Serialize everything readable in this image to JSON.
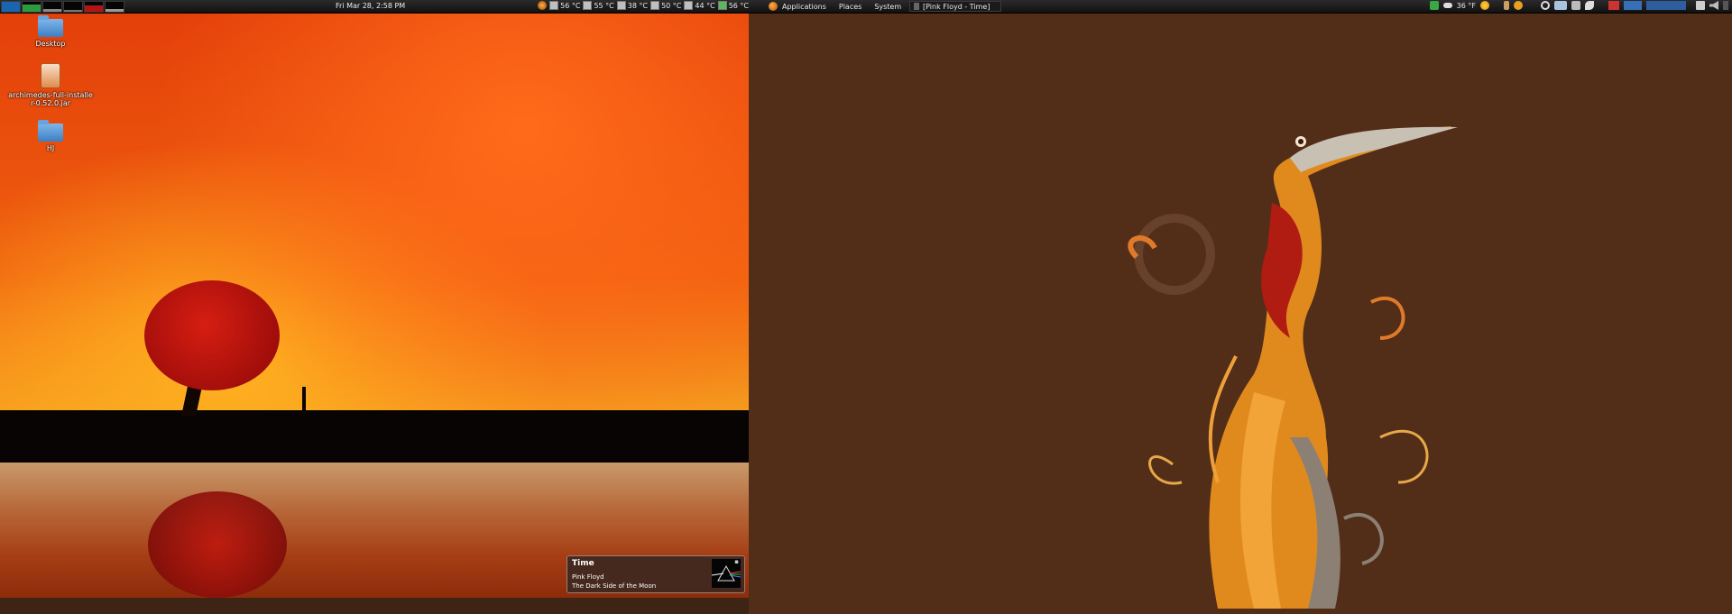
{
  "left_panel": {
    "clock": "Fri Mar 28,  2:58 PM",
    "sensors": [
      "56 °C",
      "55 °C",
      "38 °C",
      "50 °C",
      "44 °C",
      "56 °C"
    ]
  },
  "right_panel": {
    "menu": [
      "Applications",
      "Places",
      "System"
    ],
    "task": "[Pink Floyd - Time]",
    "weather": "36 °F"
  },
  "desktop_icons": [
    {
      "label": "Desktop"
    },
    {
      "label": "archimedes-full-installer-0.52.0.jar"
    },
    {
      "label": "HJ"
    }
  ],
  "notification": {
    "title": "Time",
    "artist": "Pink Floyd",
    "album": "The Dark Side of the Moon"
  }
}
